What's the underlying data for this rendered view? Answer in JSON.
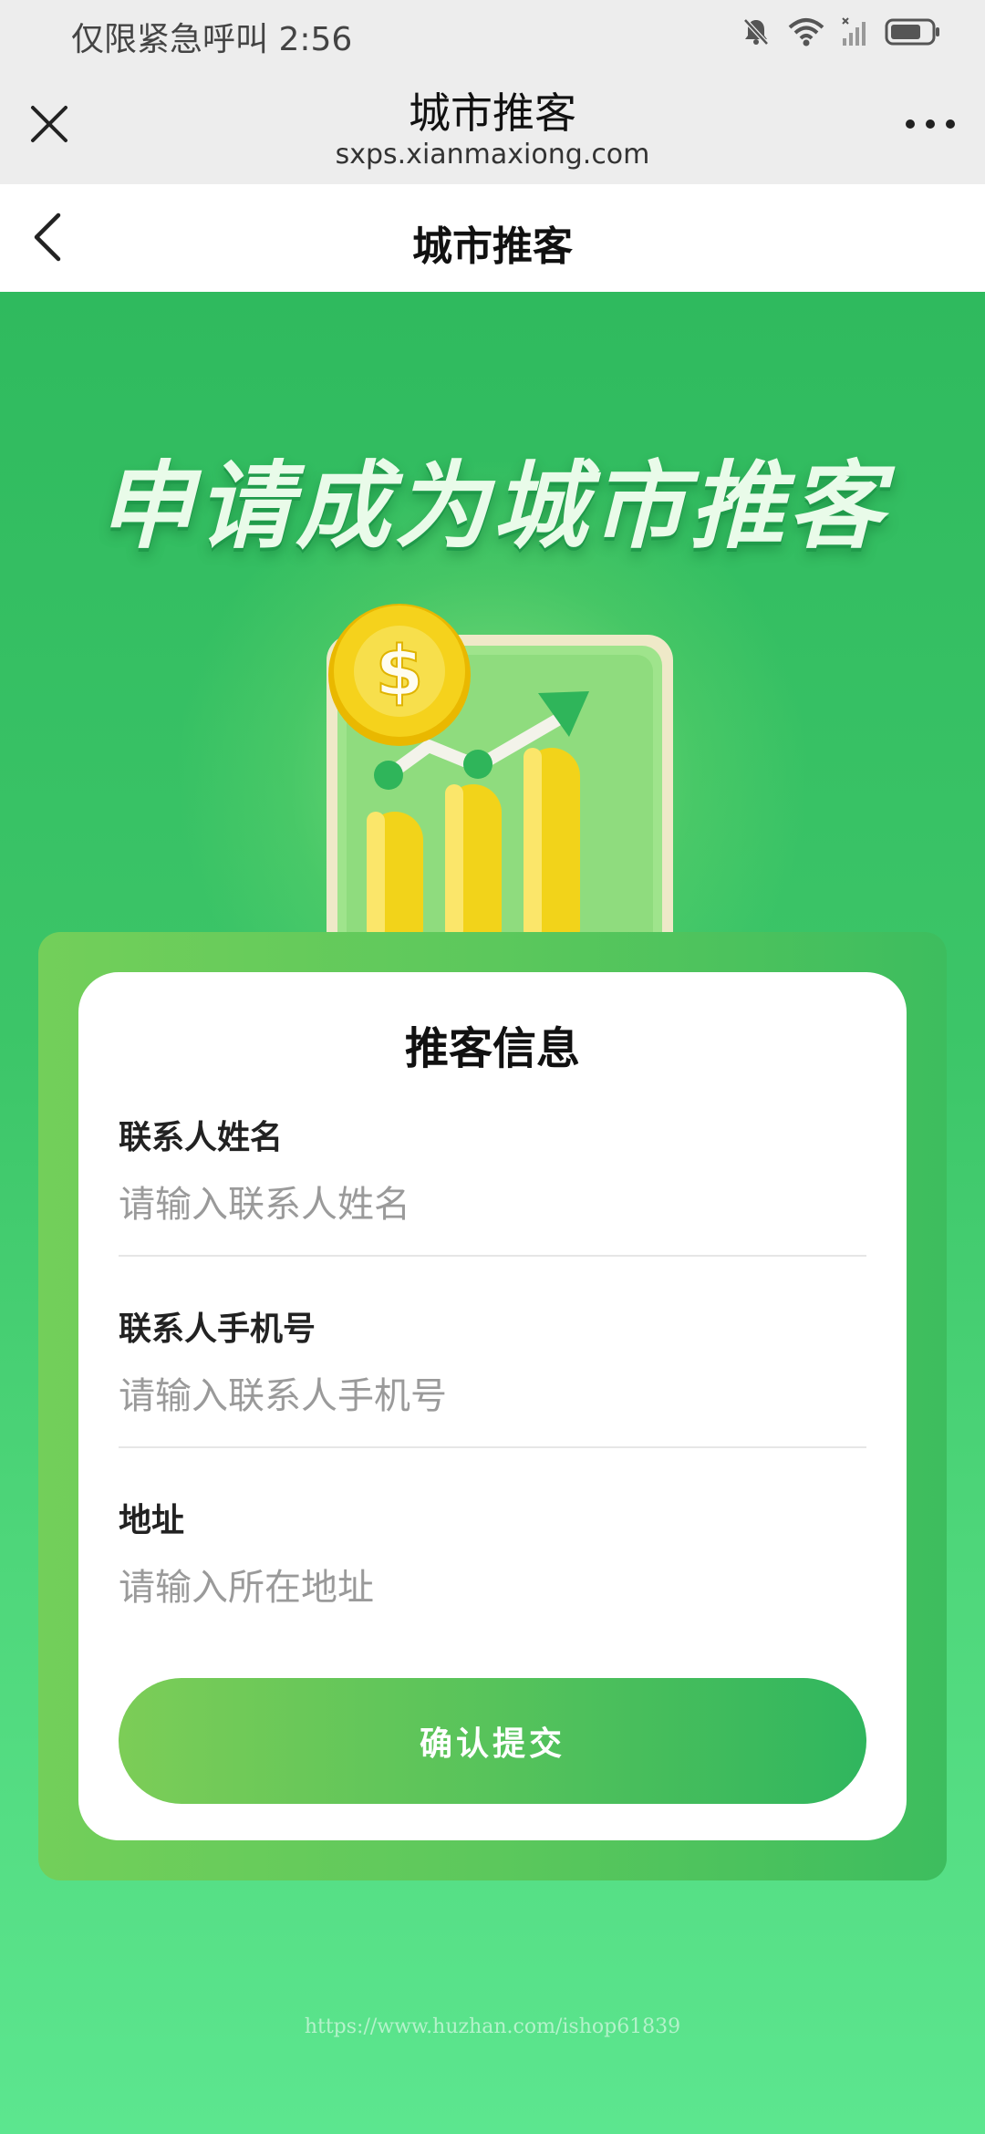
{
  "status_bar": {
    "left_text": "仅限紧急呼叫 2:56",
    "icons": [
      "bell-muted-icon",
      "wifi-icon",
      "signal-icon",
      "battery-icon"
    ]
  },
  "browser": {
    "title": "城市推客",
    "url": "sxps.xianmaxiong.com",
    "icons": [
      "close-icon",
      "more-icon"
    ]
  },
  "nav": {
    "title": "城市推客",
    "back_icon": "chevron-left-icon"
  },
  "hero": {
    "headline": "申请成为城市推客",
    "illustration": "coin-growth-chart-illustration"
  },
  "form": {
    "title": "推客信息",
    "fields": [
      {
        "label": "联系人姓名",
        "placeholder": "请输入联系人姓名",
        "value": ""
      },
      {
        "label": "联系人手机号",
        "placeholder": "请输入联系人手机号",
        "value": ""
      },
      {
        "label": "地址",
        "placeholder": "请输入所在地址",
        "value": ""
      }
    ],
    "submit_label": "确认提交"
  },
  "watermark": "https://www.huzhan.com/ishop61839",
  "colors": {
    "brand_green": "#3cc568",
    "button_start": "#7ccd57",
    "button_end": "#30b65e",
    "bottom_green": "#59e48e"
  }
}
